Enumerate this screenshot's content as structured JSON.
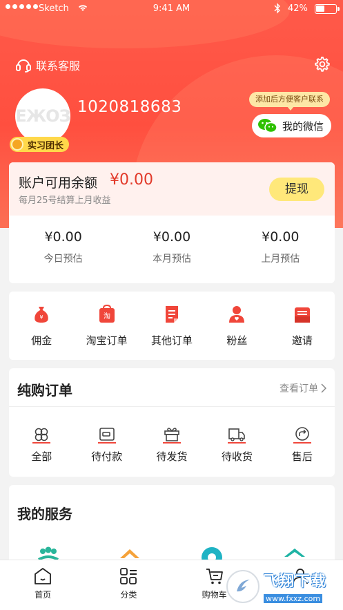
{
  "status_bar": {
    "carrier": "Sketch",
    "time": "9:41 AM",
    "battery": "42%",
    "signal_dots": 5
  },
  "header": {
    "customer_service_label": "联系客服",
    "settings_icon": "gear-icon",
    "user_id": "1020818683",
    "role_badge": "实习团长",
    "avatar_logo_text": "ЕЖОЗ",
    "wechat_tip": "添加后方便客户联系",
    "wechat_button": "我的微信"
  },
  "balance": {
    "label": "账户可用余额",
    "amount": "¥0.00",
    "note": "每月25号结算上月收益",
    "withdraw_label": "提现",
    "estimates": [
      {
        "value": "¥0.00",
        "label": "今日预估"
      },
      {
        "value": "¥0.00",
        "label": "本月预估"
      },
      {
        "value": "¥0.00",
        "label": "上月预估"
      }
    ]
  },
  "quick_actions": [
    {
      "label": "佣金",
      "icon": "money-bag-icon"
    },
    {
      "label": "淘宝订单",
      "icon": "taobao-bag-icon"
    },
    {
      "label": "其他订单",
      "icon": "document-icon"
    },
    {
      "label": "粉丝",
      "icon": "user-icon"
    },
    {
      "label": "邀请",
      "icon": "invite-card-icon"
    }
  ],
  "orders": {
    "title": "纯购订单",
    "view_all": "查看订单",
    "items": [
      {
        "label": "全部",
        "icon": "grid-icon"
      },
      {
        "label": "待付款",
        "icon": "wallet-icon"
      },
      {
        "label": "待发货",
        "icon": "gift-box-icon"
      },
      {
        "label": "待收货",
        "icon": "truck-icon"
      },
      {
        "label": "售后",
        "icon": "return-icon"
      }
    ]
  },
  "services": {
    "title": "我的服务"
  },
  "tabbar": [
    {
      "label": "首页",
      "icon": "home-icon"
    },
    {
      "label": "分类",
      "icon": "category-icon"
    },
    {
      "label": "购物车",
      "icon": "cart-icon"
    },
    {
      "label": "",
      "icon": "profile-icon"
    }
  ],
  "watermark": {
    "title": "飞翔下载",
    "url": "www.fxxz.com"
  },
  "colors": {
    "primary_red": "#ff5a4a",
    "accent_red": "#e23a2a",
    "badge_yellow": "#ffd84a",
    "withdraw_yellow": "#ffe87a",
    "wechat_green": "#2dc100"
  }
}
